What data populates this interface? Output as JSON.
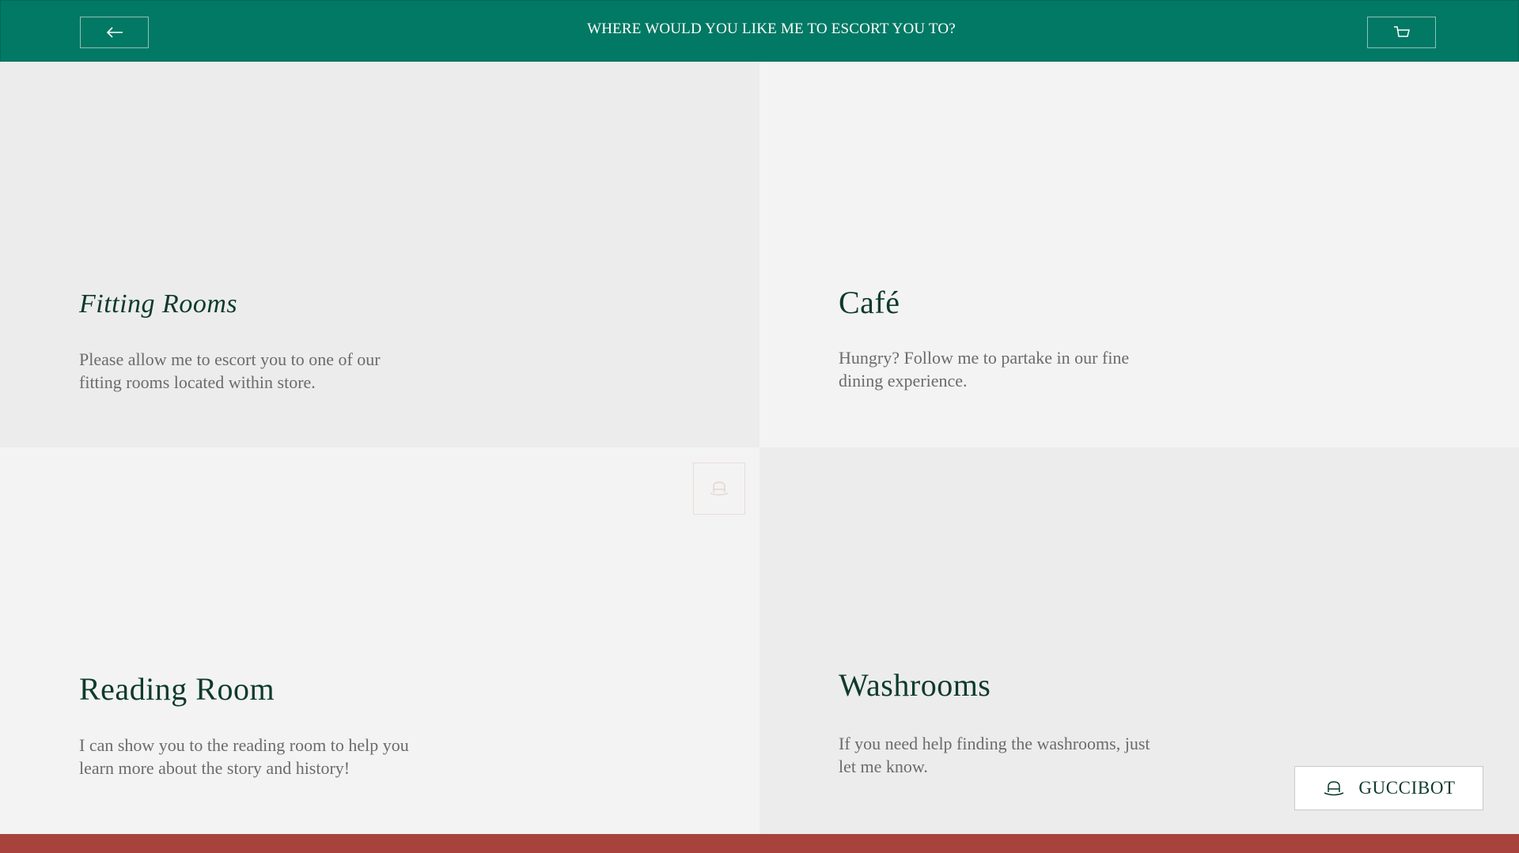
{
  "header": {
    "title": "WHERE WOULD YOU LIKE ME TO ESCORT YOU TO?",
    "back_icon": "arrow-left-icon",
    "cart_icon": "shopping-bag-icon",
    "background": "#017964"
  },
  "destinations": [
    {
      "title": "Fitting Rooms",
      "description": "Please allow me to escort you to one of our fitting rooms located within store."
    },
    {
      "title": "Café",
      "description": "Hungry? Follow me to partake in our fine dining experience."
    },
    {
      "title": "Reading Room",
      "description": "I can show you to the reading room to help you learn more about the story and history!"
    },
    {
      "title": "Washrooms",
      "description": "If you need help finding the washrooms, just let me know."
    }
  ],
  "assistant": {
    "label": "GUCCIBOT",
    "icon": "hat-icon"
  },
  "colors": {
    "brand_green": "#017964",
    "title_green": "#0d3a2c",
    "footer_red": "#a8423d"
  }
}
